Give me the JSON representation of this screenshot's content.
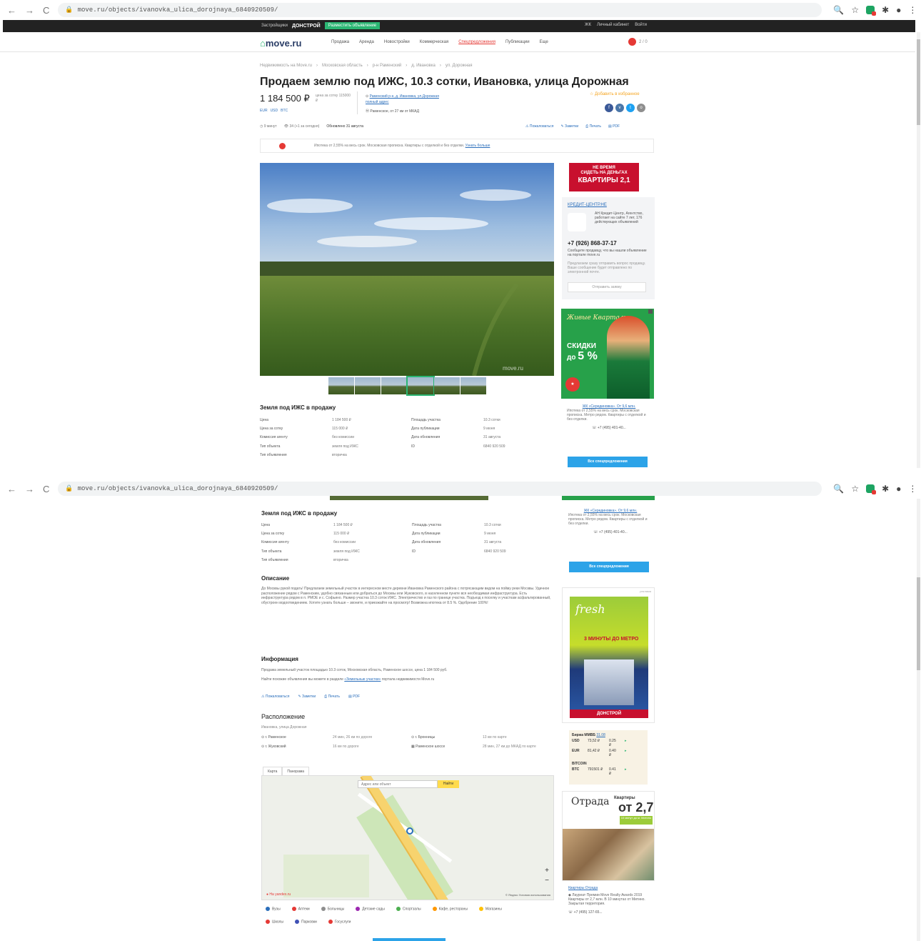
{
  "browser": {
    "url_1": "move.ru/objects/ivanovka_ulica_dorojnaya_6840920509/",
    "url_2": "move.ru/objects/ivanovka_ulica_dorojnaya_6840920509/"
  },
  "topbar": {
    "left_link": "Застройщики",
    "brand": "ДОНСТРОЙ",
    "cta": "Разместить объявление",
    "right_items": [
      "ЖК",
      "Личный кабинет",
      "Войти"
    ]
  },
  "header": {
    "logo": "move.ru",
    "menu": [
      "Продажа",
      "Аренда",
      "Новостройки",
      "Коммерческая",
      "Спецпредложения",
      "Публикации",
      "Еще"
    ],
    "fav_count": "2 / 0"
  },
  "breadcrumbs": [
    "Недвижимость на Move.ru",
    "Московская область",
    "р-н Раменский",
    "д. Ивановка",
    "ул. Дорожная"
  ],
  "listing": {
    "title": "Продаем землю под ИЖС, 10.3 сотки, Ивановка, улица Дорожная",
    "price": "1 184 500 ₽",
    "price_per": "цена за сотку 115000 ₽",
    "currency_links": [
      "EUR",
      "USD",
      "BTC"
    ],
    "address_links": "Раменский р-н, д. Ивановка, ул.Дорожная",
    "address_full": "полный адрес",
    "metro": "Раменское, от 27 км от МКАД",
    "favorite": "Добавить в избранное",
    "stats": [
      "9 минут",
      "34 (+1 за сегодня)",
      "Обновлено 31 августа"
    ],
    "actions": [
      "Пожаловаться",
      "Заметки",
      "Печать",
      "PDF"
    ],
    "promo": "Ипотека от 2,55% на весь срок. Московская прописка. Квартиры с отделкой и без отделки.",
    "promo_link": "Узнать больше"
  },
  "ads": {
    "ad1_line1": "НЕ ВРЕМЯ",
    "ad1_line2": "СИДЕТЬ НА ДЕНЬГАХ",
    "ad1_big": "КВАРТИРЫ 2,1",
    "agent_name": "КРЕДИТ-ЦЕНТР.НЕ",
    "agent_info": "АН Кредит-Центр, Агентство, работает на сайте 7 лет, 176 действующих объявлений",
    "agent_phone": "+7 (926) 868-37-17",
    "agent_note": "Сообщите продавцу, что вы нашли объявление на портале move.ru",
    "agent_grey": "Предлагаем сразу отправить вопрос продавцу. Ваше сообщение будет отправлено по электронной почте.",
    "agent_button": "Отправить заявку",
    "ad2_title": "Живые Кварталы",
    "ad2_text1": "СКИДКИ",
    "ad2_text2": "до",
    "ad2_pct": "5 %",
    "ad2_link": "ЖК «Серединовка». От 9,6 млн.",
    "ad2_desc": "Ипотека от 2,55% на весь срок. Московская прописка. Метро рядом. Квартиры с отделкой и без отделки.",
    "ad2_phone": "+7 (495) 401-40...",
    "all_offers": "Все спецпредложения",
    "ad3_title": "3 МИНУТЫ ДО МЕТРО",
    "ad3_brand": "fresh",
    "ad3_footer": "ДОНСТРОЙ",
    "ad3_label": "реклама",
    "ad4_brand": "Отрада",
    "ad4_title": "Квартиры",
    "ad4_price": "от 2,7",
    "ad4_green": "10 минут до м. Митино",
    "ad4_link": "Квартиры Отрада",
    "ad4_award": "Лауреат Премии Move Realty Awards 2019",
    "ad4_desc": "Квартиры от 2,7 млн. В 10 минутах от Митино. Закрытая территория.",
    "ad4_phone": "+7 (495) 127-65..."
  },
  "details": {
    "heading": "Земля под ИЖС в продажу",
    "left": [
      {
        "k": "Цена",
        "v": "1 184 500 ₽"
      },
      {
        "k": "Цена за сотку",
        "v": "115 000 ₽"
      },
      {
        "k": "Комиссия агенту",
        "v": "без комиссии"
      },
      {
        "k": "Тип объекта",
        "v": "земля под ИЖС"
      },
      {
        "k": "Тип объявления",
        "v": "вторичка"
      }
    ],
    "right": [
      {
        "k": "Площадь участка",
        "v": "10.3 сотки"
      },
      {
        "k": "Дата публикации",
        "v": "9 июня"
      },
      {
        "k": "Дата обновления",
        "v": "31 августа"
      },
      {
        "k": "ID",
        "v": "6840 920 509"
      }
    ]
  },
  "description": {
    "heading": "Описание",
    "text": "До Москвы рукой подать! Предлагаем земельный участок в интересном месте деревни Ивановка Раменского района с потрясающим видом на пойму реки Москвы. Удачное расположение рядом с Раменским, удобно связанным или добраться до Москвы или Жуковского, в населенном пункте вся необходимая инфраструктура. Есть инфраструктура рядом в п. РМОЕ и с. Софьино. Размер участка 10.3 соток ИЖС. Электричество и газ по границе участка. Подъезд к поселку и участкам асфальтированный, обустроен водоотведением. Хотите узнать больше – звоните, и приезжайте на просмотр! Возможна ипотека от 8.5 %. Одобрение 100%!"
  },
  "information": {
    "heading": "Информация",
    "p1": "Продажа земельный участок площадью 10.3 соток, Московская область, Раменское шоссе, цена 1 184 500 руб.",
    "p2_prefix": "Найти похожие объявления вы можете в разделе",
    "p2_link": "«Земельные участки»",
    "p2_suffix": "портала недвижимости Move.ru"
  },
  "location": {
    "heading": "Расположение",
    "subtitle": "Ивановка, улица Дорожная",
    "rows": [
      [
        "г. Раменское",
        "24 мин, 26 км по дороге",
        "г. Бронницы",
        "13 км по карте"
      ],
      [
        "г. Жуковский",
        "16 км по дороге",
        "Раменское шоссе",
        "28 мин, 27 км до МКАД по карте"
      ]
    ],
    "tabs": [
      "Карта",
      "Панорама"
    ],
    "search_placeholder": "Адрес или объект",
    "find": "Найти",
    "yandex": "На yandex.ru",
    "terms": "© Яндекс Условия использования",
    "poi_row1": [
      "Вузы",
      "Аптеки",
      "Больницы",
      "Детские сады",
      "Спортзалы",
      "Кафе, рестораны",
      "Магазины"
    ],
    "poi_row2": [
      "Школы",
      "Парковки",
      "Госуслуги"
    ]
  },
  "rates": {
    "heading": "Биржа ММВБ",
    "date": "31.08",
    "rows": [
      [
        "USD",
        "73,52 ₽",
        "0.25 ₽"
      ],
      [
        "EUR",
        "81,42 ₽",
        "0.40 ₽"
      ]
    ],
    "btc_heading": "BITCOIN",
    "btc": [
      "BTC",
      "791501 ₽",
      "0.41 ₽"
    ]
  },
  "colors": {
    "accent_green": "#2bb673",
    "link_blue": "#2a6ebb",
    "button_blue": "#2ca3e8",
    "fav_orange": "#f5a623",
    "brand_dark": "#2a3d66"
  }
}
